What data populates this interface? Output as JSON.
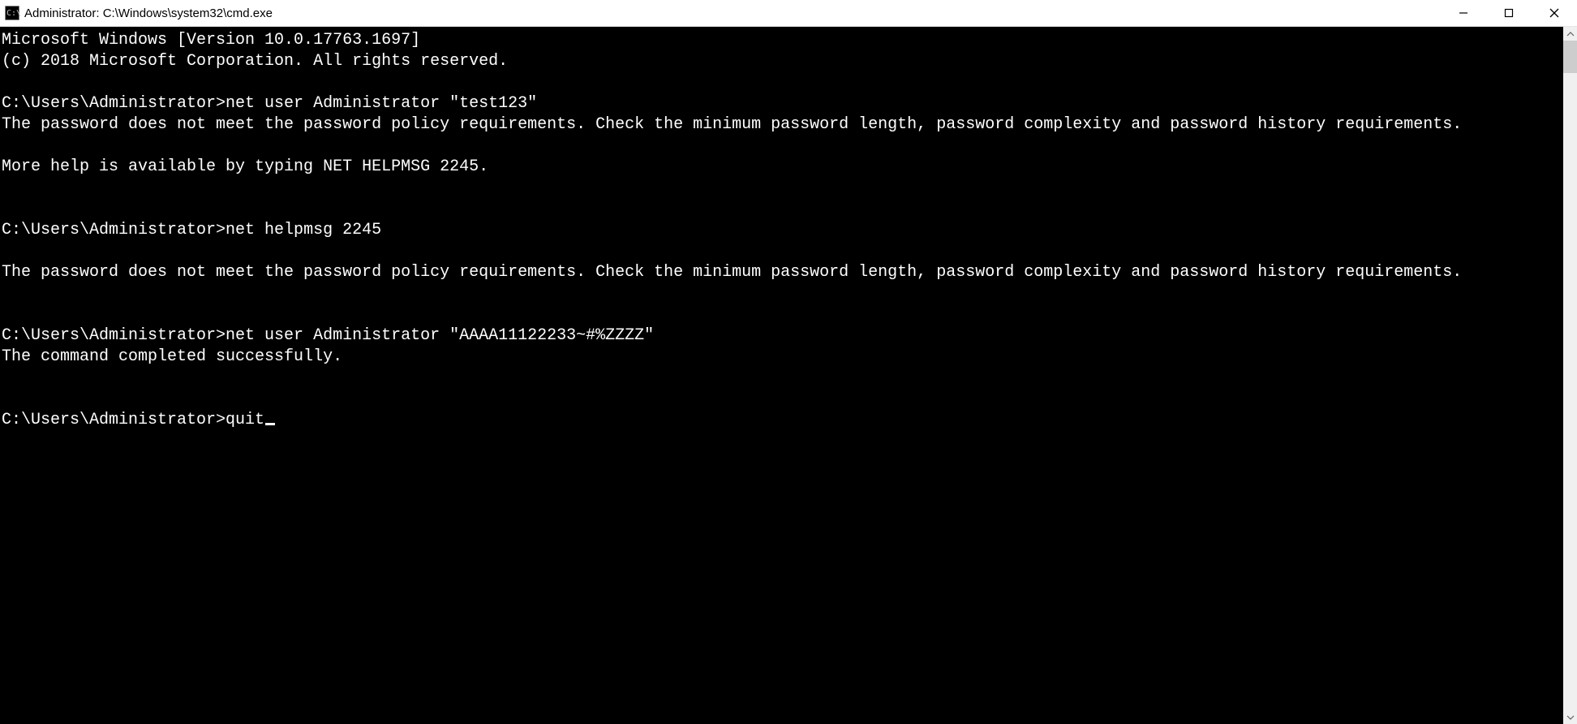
{
  "window": {
    "title": "Administrator: C:\\Windows\\system32\\cmd.exe"
  },
  "terminal": {
    "banner_line1": "Microsoft Windows [Version 10.0.17763.1697]",
    "banner_line2": "(c) 2018 Microsoft Corporation. All rights reserved.",
    "blocks": [
      {
        "prompt": "C:\\Users\\Administrator>",
        "command": "net user Administrator \"test123\"",
        "output": "The password does not meet the password policy requirements. Check the minimum password length, password complexity and password history requirements.\n\nMore help is available by typing NET HELPMSG 2245."
      },
      {
        "prompt": "C:\\Users\\Administrator>",
        "command": "net helpmsg 2245",
        "output": "\nThe password does not meet the password policy requirements. Check the minimum password length, password complexity and password history requirements."
      },
      {
        "prompt": "C:\\Users\\Administrator>",
        "command": "net user Administrator \"AAAA11122233~#%ZZZZ\"",
        "output": "The command completed successfully."
      }
    ],
    "current": {
      "prompt": "C:\\Users\\Administrator>",
      "input": "quit"
    }
  }
}
